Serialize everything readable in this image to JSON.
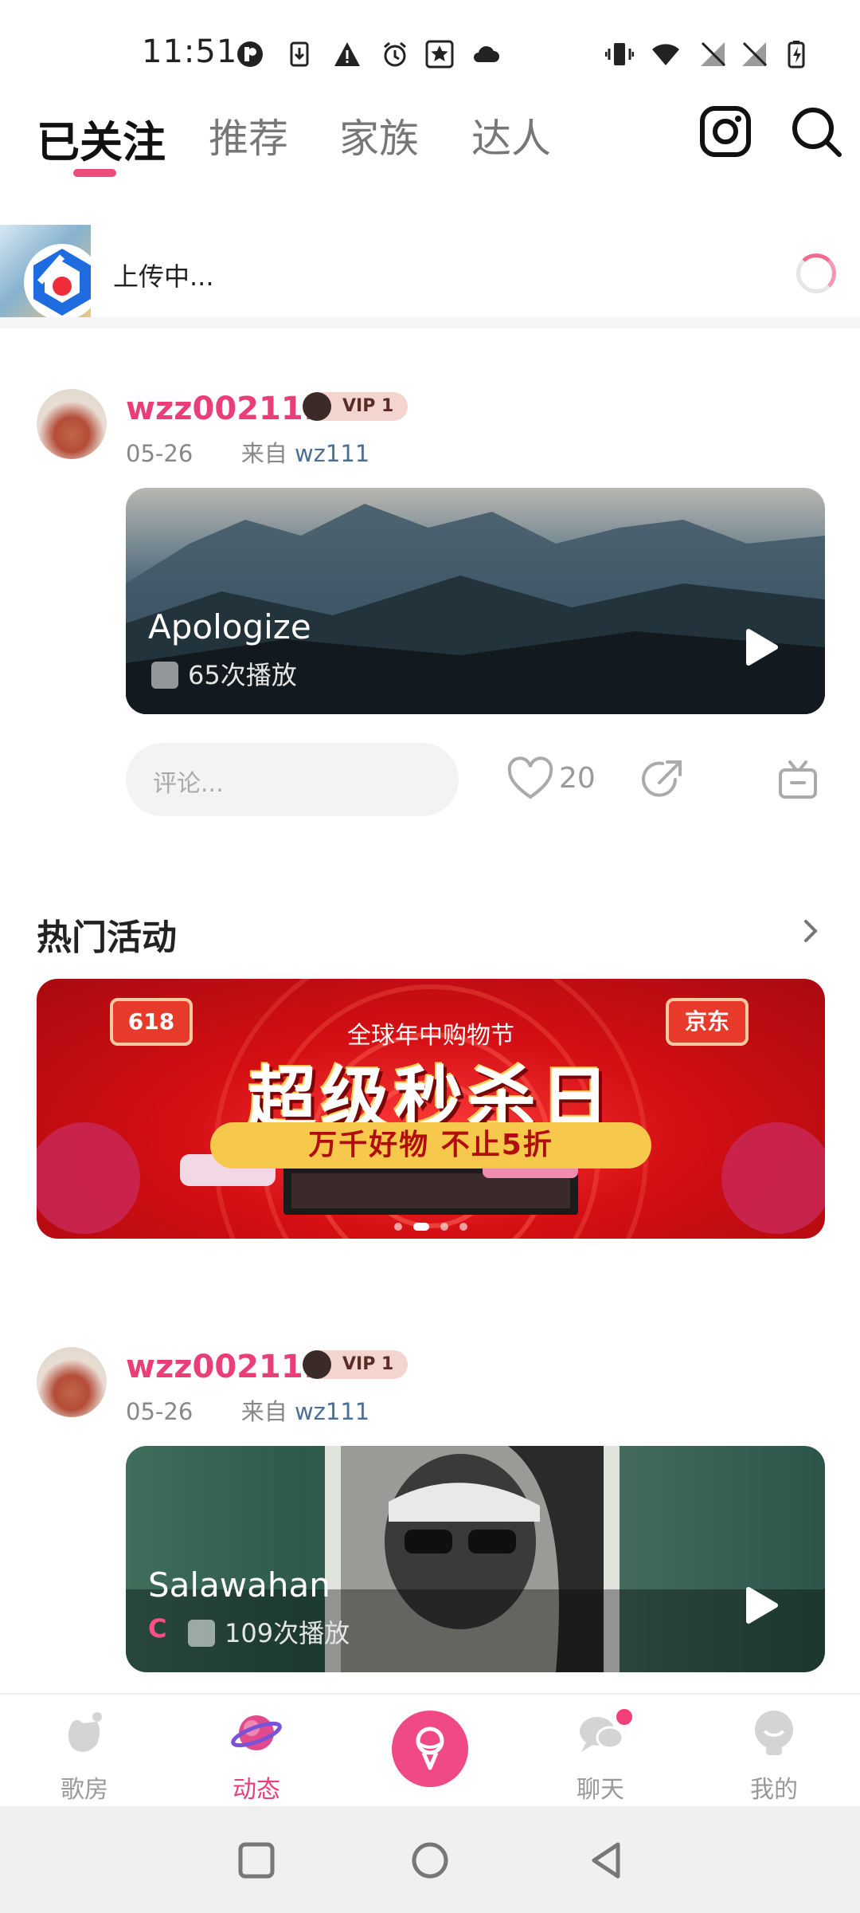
{
  "status_bar": {
    "time": "11:51",
    "icons": [
      "profile-app-icon",
      "download-icon",
      "warning-icon",
      "alarm-icon",
      "star-app-icon",
      "cloud-icon",
      "vibrate-icon",
      "wifi-icon",
      "signal-off-icon",
      "signal-off-icon",
      "battery-charging-icon"
    ]
  },
  "top_tabs": {
    "items": [
      {
        "label": "已关注",
        "active": true
      },
      {
        "label": "推荐",
        "active": false
      },
      {
        "label": "家族",
        "active": false
      },
      {
        "label": "达人",
        "active": false
      }
    ],
    "accent": "#ee4a7c"
  },
  "upload": {
    "status_text": "上传中..."
  },
  "posts": [
    {
      "username": "wzz002111",
      "vip": "VIP 1",
      "date": "05-26",
      "from_label": "来自",
      "from_user": "wz111",
      "song_title": "Apologize",
      "plays": "65次播放",
      "like_count": "20",
      "comment_placeholder": "评论..."
    },
    {
      "username": "wzz002111",
      "vip": "VIP 1",
      "date": "05-26",
      "from_label": "来自",
      "from_user": "wz111",
      "song_title": "Salawahan",
      "grade": "C",
      "plays": "109次播放"
    }
  ],
  "hot_section": {
    "title": "热门活动",
    "banner": {
      "left_tag": "618",
      "right_tag": "京东",
      "subtitle": "全球年中购物节",
      "headline": "超级秒杀日",
      "slogan": "万千好物 不止5折",
      "dots": 4,
      "active_dot": 1
    }
  },
  "bottom_nav": {
    "items": [
      {
        "label": "歌房",
        "icon": "room-icon",
        "active": false
      },
      {
        "label": "动态",
        "icon": "planet-icon",
        "active": true
      },
      {
        "label": "",
        "icon": "microphone-icon",
        "active": false
      },
      {
        "label": "聊天",
        "icon": "chat-icon",
        "active": false
      },
      {
        "label": "我的",
        "icon": "profile-icon",
        "active": false
      }
    ],
    "active_color": "#ea3e78"
  }
}
